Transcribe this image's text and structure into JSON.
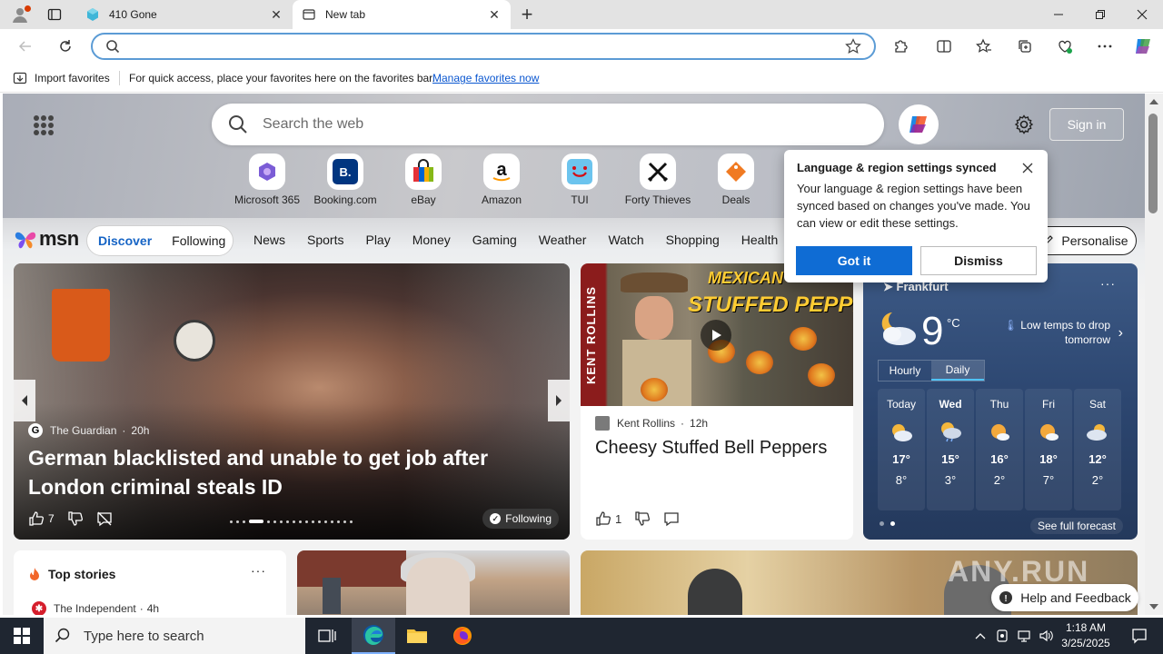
{
  "browser": {
    "tabs": [
      {
        "title": "410 Gone",
        "active": false
      },
      {
        "title": "New tab",
        "active": true
      }
    ],
    "address_value": "",
    "icons": [
      "profile-icon",
      "tab-actions-icon",
      "back-icon",
      "refresh-icon",
      "search-icon",
      "favorite-star-icon",
      "extensions-icon",
      "split-screen-icon",
      "favorites-icon",
      "collections-icon",
      "browser-essentials-icon",
      "more-icon",
      "copilot-icon"
    ]
  },
  "favorites_bar": {
    "import_label": "Import favorites",
    "message": "For quick access, place your favorites here on the favorites bar.",
    "manage_link": "Manage favorites now"
  },
  "newtab": {
    "search_placeholder": "Search the web",
    "sign_in": "Sign in",
    "quick_links": [
      {
        "label": "Microsoft 365",
        "color": "#7b5cd6"
      },
      {
        "label": "Booking.com",
        "color": "#003580"
      },
      {
        "label": "eBay",
        "color": "#e53238"
      },
      {
        "label": "Amazon",
        "color": "#111111"
      },
      {
        "label": "TUI",
        "color": "#6cc4ee"
      },
      {
        "label": "Forty Thieves",
        "color": "#111111"
      },
      {
        "label": "Deals",
        "color": "#f07a22"
      }
    ]
  },
  "msn": {
    "logo_text": "msn",
    "segments": [
      "Discover",
      "Following"
    ],
    "nav": [
      "News",
      "Sports",
      "Play",
      "Money",
      "Gaming",
      "Weather",
      "Watch",
      "Shopping",
      "Health"
    ],
    "personalise": "Personalise"
  },
  "hero": {
    "source": "The Guardian",
    "age": "20h",
    "title": "German blacklisted and unable to get job after London criminal steals ID",
    "likes": "7",
    "following": "Following"
  },
  "recipe": {
    "overlay_line1": "MEXICAN",
    "overlay_line2": "STUFFED PEPPERS",
    "banner": "KENT ROLLINS",
    "source": "Kent Rollins",
    "age": "12h",
    "title": "Cheesy Stuffed Bell Peppers",
    "likes": "1"
  },
  "weather": {
    "location": "Frankfurt",
    "temp": "9",
    "unit": "°C",
    "alert": "Low temps to drop tomorrow",
    "modes": [
      "Hourly",
      "Daily"
    ],
    "days": [
      {
        "name": "Today",
        "hi": "17°",
        "lo": "8°"
      },
      {
        "name": "Wed",
        "hi": "15°",
        "lo": "3°"
      },
      {
        "name": "Thu",
        "hi": "16°",
        "lo": "2°"
      },
      {
        "name": "Fri",
        "hi": "18°",
        "lo": "7°"
      },
      {
        "name": "Sat",
        "hi": "12°",
        "lo": "2°"
      }
    ],
    "full_forecast": "See full forecast"
  },
  "popup": {
    "title": "Language & region settings synced",
    "body": "Your language & region settings have been synced based on changes you've made. You can view or edit these settings.",
    "got_it": "Got it",
    "dismiss": "Dismiss"
  },
  "top_stories": {
    "title": "Top stories",
    "source": "The Independent",
    "age": "4h"
  },
  "help": "Help and Feedback",
  "watermark": "ANY.RUN",
  "taskbar": {
    "search_placeholder": "Type here to search",
    "time": "1:18 AM",
    "date": "3/25/2025"
  }
}
